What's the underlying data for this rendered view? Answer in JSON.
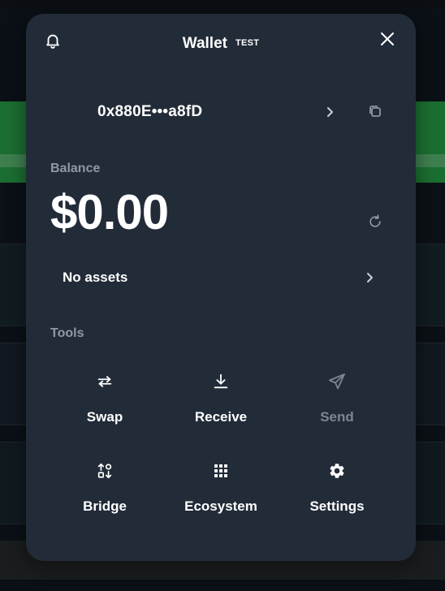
{
  "header": {
    "title": "Wallet",
    "network_tag": "TEST"
  },
  "account": {
    "address": "0x880E•••a8fD"
  },
  "balance": {
    "label": "Balance",
    "amount": "$0.00"
  },
  "assets": {
    "label": "No assets"
  },
  "tools": {
    "label": "Tools",
    "items": [
      {
        "label": "Swap",
        "icon": "swap-icon",
        "enabled": true
      },
      {
        "label": "Receive",
        "icon": "download-icon",
        "enabled": true
      },
      {
        "label": "Send",
        "icon": "send-icon",
        "enabled": false
      },
      {
        "label": "Bridge",
        "icon": "bridge-icon",
        "enabled": true
      },
      {
        "label": "Ecosystem",
        "icon": "grid-icon",
        "enabled": true
      },
      {
        "label": "Settings",
        "icon": "gear-icon",
        "enabled": true
      }
    ]
  },
  "colors": {
    "modal_bg": "#222b38",
    "muted_text": "#8e98a6",
    "disabled_text": "#7d8591",
    "background_green": "#1b6e31"
  }
}
